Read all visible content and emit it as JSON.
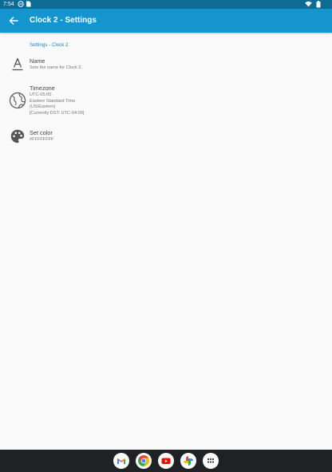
{
  "status_bar": {
    "time": "7:54",
    "icons": [
      "notification-dnd-icon",
      "sim-card-icon",
      "wifi-icon",
      "battery-icon"
    ]
  },
  "app_bar": {
    "title": "Clock 2 - Settings",
    "back_icon": "arrow-back-icon"
  },
  "section_header": "Settings - Clock 2",
  "preferences": [
    {
      "icon": "font-a-icon",
      "title": "Name",
      "summary": [
        "Sets the name for Clock 2."
      ]
    },
    {
      "icon": "globe-icon",
      "title": "Timezone",
      "summary": [
        "UTC-05:00",
        "Eastern Standard Time",
        "(US/Eastern)",
        "[Currently DST: UTC-04:00]"
      ]
    },
    {
      "icon": "palette-icon",
      "title": "Set color",
      "summary": [
        "#FFFFFFFF"
      ]
    }
  ],
  "dock": {
    "apps": [
      "gmail-icon",
      "chrome-icon",
      "youtube-icon",
      "photos-icon",
      "app-drawer-icon"
    ]
  },
  "colors": {
    "status_bar": "#0d6c95",
    "app_bar": "#1595cd",
    "accent": "#1a84c9",
    "background": "#fafafa",
    "nav_bar": "#202124"
  }
}
